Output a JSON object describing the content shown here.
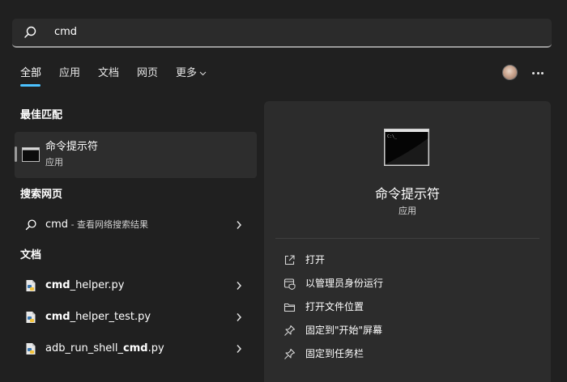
{
  "search": {
    "query": "cmd"
  },
  "tabs": [
    {
      "label": "全部"
    },
    {
      "label": "应用"
    },
    {
      "label": "文档"
    },
    {
      "label": "网页"
    },
    {
      "label": "更多"
    }
  ],
  "sections": {
    "best_match": "最佳匹配",
    "web": "搜索网页",
    "docs": "文档"
  },
  "best_match": {
    "title": "命令提示符",
    "subtitle": "应用"
  },
  "web_result": {
    "query": "cmd",
    "suffix": " - 查看网络搜索结果"
  },
  "documents": [
    {
      "bold": "cmd",
      "rest": "_helper.py",
      "prefix": ""
    },
    {
      "bold": "cmd",
      "rest": "_helper_test.py",
      "prefix": ""
    },
    {
      "bold": "cmd",
      "rest": ".py",
      "prefix": "adb_run_shell_"
    }
  ],
  "panel": {
    "title": "命令提示符",
    "subtitle": "应用",
    "actions": [
      {
        "label": "打开",
        "icon": "open-external-icon"
      },
      {
        "label": "以管理员身份运行",
        "icon": "admin-shield-icon"
      },
      {
        "label": "打开文件位置",
        "icon": "folder-icon"
      },
      {
        "label": "固定到\"开始\"屏幕",
        "icon": "pin-icon"
      },
      {
        "label": "固定到任务栏",
        "icon": "pin-icon"
      }
    ]
  },
  "colors": {
    "accent": "#4cc2ff",
    "background": "#202020",
    "panel": "#2c2c2c"
  }
}
